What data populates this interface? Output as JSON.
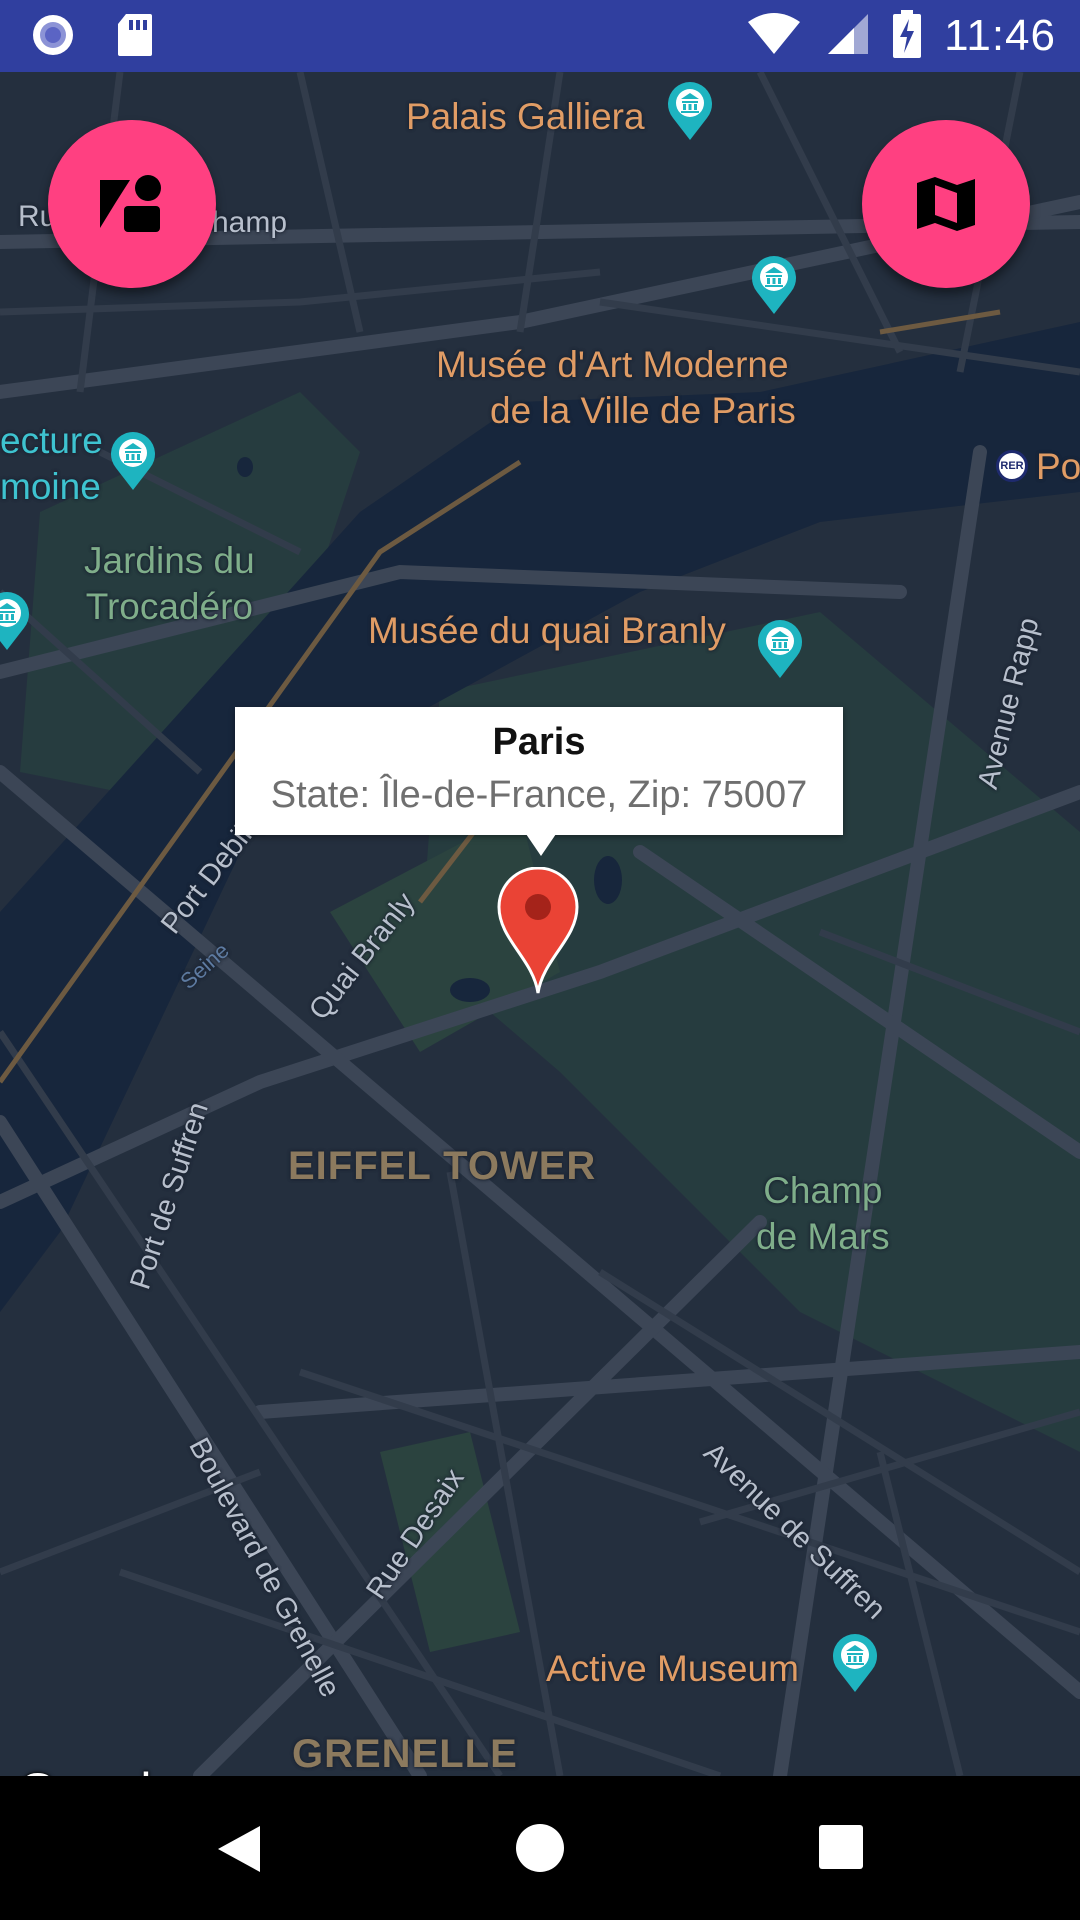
{
  "status_bar": {
    "time": "11:46",
    "icons": [
      "radio-icon",
      "sd-card-icon",
      "wifi-icon",
      "signal-icon",
      "battery-charging-icon"
    ]
  },
  "map": {
    "poi_labels": {
      "palais_galliera": "Palais Galliera",
      "musee_art_moderne_1": "Musée d'Art Moderne",
      "musee_art_moderne_2": "de la Ville de Paris",
      "cite_architecture_1": "ecture",
      "cite_architecture_2": "moine",
      "musee_quai_branly": "Musée du quai Branly",
      "active_museum": "Active Museum",
      "po": "Po"
    },
    "park_labels": {
      "jardins_1": "Jardins du",
      "jardins_2": "Trocadéro",
      "champ_1": "Champ",
      "champ_2": "de Mars"
    },
    "street_labels": {
      "rue_champ": "Ru",
      "rue_champ_end": "hamp",
      "port_debilly": "Port Debilly",
      "quai_branly": "Quai Branly",
      "port_de_suffren": "Port de Suffren",
      "avenue_rapp": "Avenue Rapp",
      "boulevard_de_grenelle": "Boulevard de Grenelle",
      "rue_desaix": "Rue Desaix",
      "avenue_de_suffren": "Avenue de Suffren"
    },
    "water_label": "Seine",
    "district_labels": {
      "eiffel_tower": "EIFFEL TOWER",
      "grenelle": "GRENELLE"
    },
    "rer_badge": "RER",
    "logo": "Google"
  },
  "info_window": {
    "title": "Paris",
    "snippet": "State: Île-de-France, Zip: 75007"
  },
  "fabs": {
    "left_icon": "map-style-icon",
    "right_icon": "map-icon"
  },
  "colors": {
    "status_bar": "#303f9f",
    "fab": "#ff4081",
    "map_background": "#242f3e",
    "water": "#17263c",
    "park": "#263c3f",
    "marker": "#ea4335",
    "poi_text": "#e09c65"
  },
  "nav_bar": {
    "buttons": [
      "back-icon",
      "home-icon",
      "recents-icon"
    ]
  }
}
